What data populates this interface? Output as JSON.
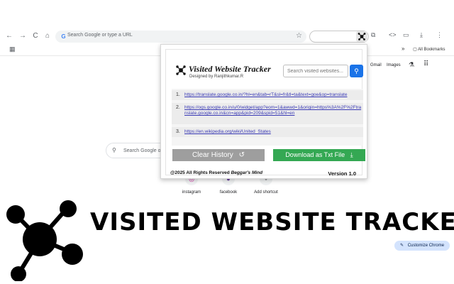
{
  "browser": {
    "omnibox_placeholder": "Search Google or type a URL",
    "all_bookmarks": "All Bookmarks",
    "bookmark_chevron": "»"
  },
  "google": {
    "gmail": "Gmail",
    "images": "Images",
    "search_placeholder": "Search Google o",
    "shortcuts": [
      "instagram",
      "facebook",
      "Add shortcut"
    ],
    "customize": "Customize Chrome"
  },
  "popup": {
    "title": "Visited Website Tracker",
    "subtitle": "Designed by Ranjithkumar.R",
    "search_placeholder": "Search visited websites...",
    "entries": [
      {
        "num": "1.",
        "url": "https://translate.google.co.in/?hl=en&tab=rT&sl=fr&tl=ta&text=goe&op=translate"
      },
      {
        "num": "2.",
        "url": "https://ogs.google.co.in/u/0/widget/app?eom=1&awwd=1&origin=https%3A%2F%2Ftranslate.google.co.in&cn=app&pid=209&spid=51&hl=en"
      },
      {
        "num": "3.",
        "url": "https://en.wikipedia.org/wiki/United_States"
      }
    ],
    "clear_label": "Clear History",
    "download_label": "Download as Txt File",
    "footer_prefix": "@2025 All Rights Reserved",
    "footer_brand": "Beggar's Mind",
    "version": "Version 1.0"
  },
  "banner": {
    "title": "VISITED WEBSITE TRACKER"
  },
  "colors": {
    "accent_blue": "#1a73e8",
    "download_green": "#34a853",
    "clear_gray": "#9e9e9e",
    "link": "#3a3ab5"
  }
}
